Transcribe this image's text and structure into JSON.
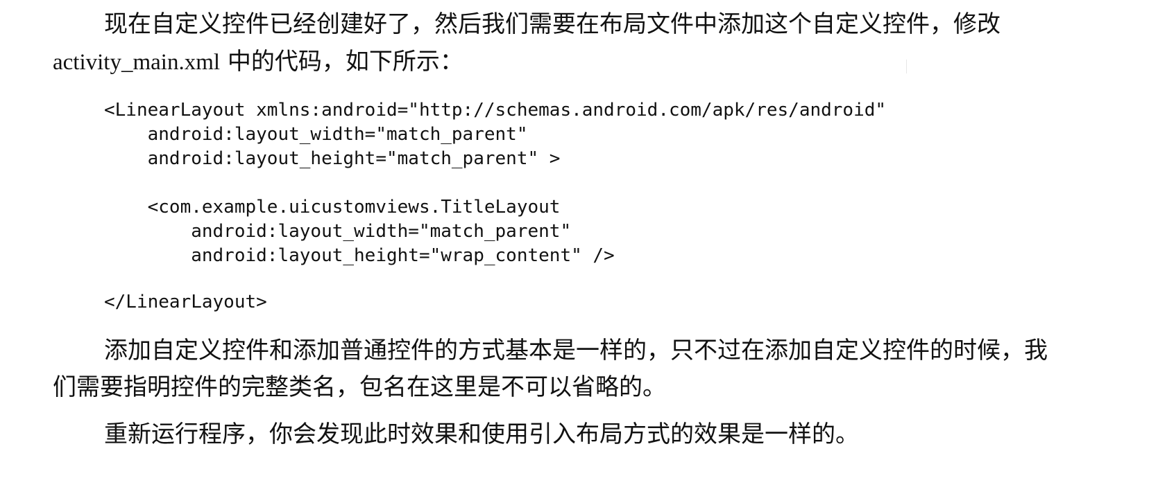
{
  "paragraphs": {
    "intro_line1": "现在自定义控件已经创建好了，然后我们需要在布局文件中添加这个自定义控件，修改",
    "intro_file": "activity_main.xml",
    "intro_line2_rest": " 中的代码，如下所示：",
    "explain_line1": "添加自定义控件和添加普通控件的方式基本是一样的，只不过在添加自定义控件的时候，我",
    "explain_line2": "们需要指明控件的完整类名，包名在这里是不可以省略的。",
    "rerun": "重新运行程序，你会发现此时效果和使用引入布局方式的效果是一样的。"
  },
  "code": {
    "lines": [
      "<LinearLayout xmlns:android=\"http://schemas.android.com/apk/res/android\"",
      "    android:layout_width=\"match_parent\"",
      "    android:layout_height=\"match_parent\" >",
      "",
      "    <com.example.uicustomviews.TitleLayout",
      "        android:layout_width=\"match_parent\"",
      "        android:layout_height=\"wrap_content\" />",
      "",
      "</LinearLayout>"
    ]
  }
}
